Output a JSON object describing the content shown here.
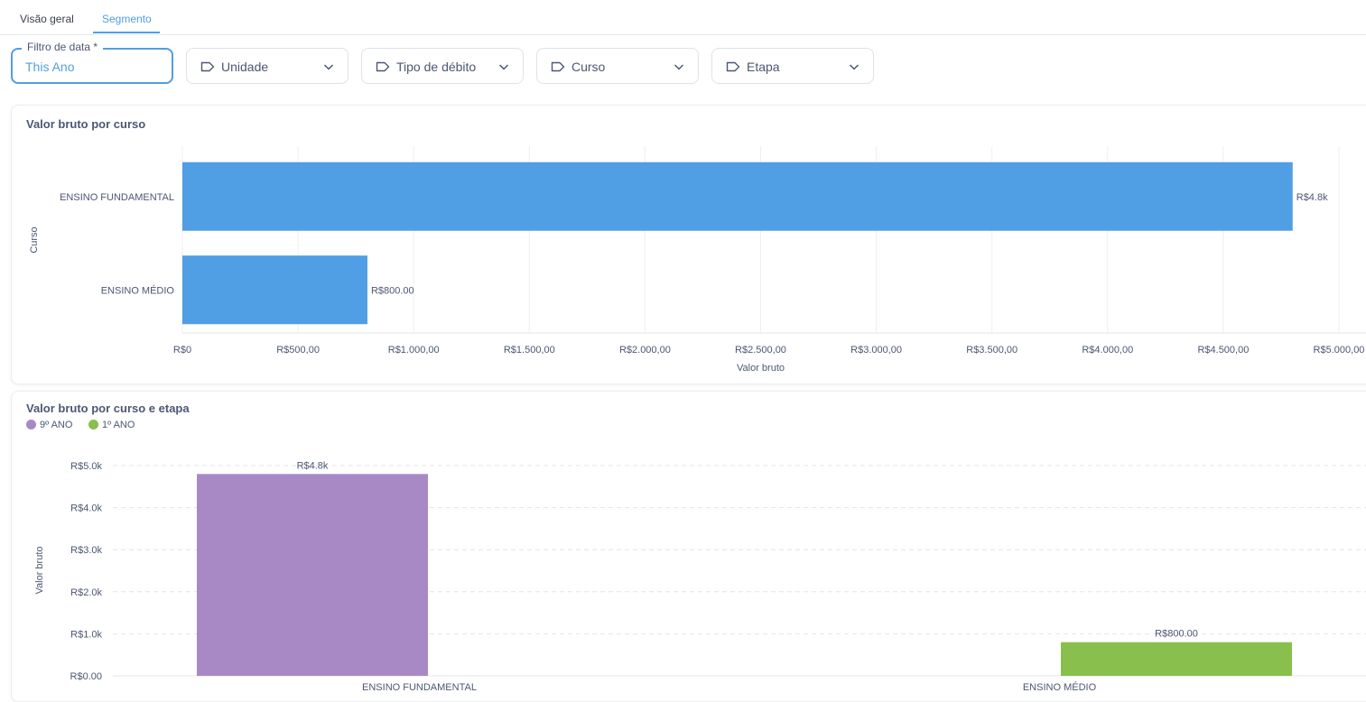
{
  "tabs": [
    {
      "label": "Visão geral",
      "active": false
    },
    {
      "label": "Segmento",
      "active": true
    }
  ],
  "filters": {
    "date": {
      "legend": "Filtro de data *",
      "value": "This Ano"
    },
    "items": [
      {
        "label": "Unidade",
        "icon": "tag-icon"
      },
      {
        "label": "Tipo de débito",
        "icon": "tag-icon"
      },
      {
        "label": "Curso",
        "icon": "tag-icon"
      },
      {
        "label": "Etapa",
        "icon": "tag-icon"
      }
    ]
  },
  "colors": {
    "accent": "#509ee3",
    "purple": "#a989c5",
    "green": "#88bf4d"
  },
  "chart_data": [
    {
      "type": "bar",
      "orientation": "horizontal",
      "title": "Valor bruto por curso",
      "xlabel": "Valor bruto",
      "ylabel": "Curso",
      "categories": [
        "ENSINO FUNDAMENTAL",
        "ENSINO MÉDIO"
      ],
      "values": [
        4800,
        800
      ],
      "data_labels": [
        "R$4.8k",
        "R$800.00"
      ],
      "xlim": [
        0,
        5000
      ],
      "x_ticks": [
        0,
        500,
        1000,
        1500,
        2000,
        2500,
        3000,
        3500,
        4000,
        4500,
        5000
      ],
      "x_tick_labels": [
        "R$0",
        "R$500,00",
        "R$1.000,00",
        "R$1.500,00",
        "R$2.000,00",
        "R$2.500,00",
        "R$3.000,00",
        "R$3.500,00",
        "R$4.000,00",
        "R$4.500,00",
        "R$5.000,00"
      ],
      "color": "#509ee3",
      "grid": true
    },
    {
      "type": "bar",
      "title": "Valor bruto por curso e etapa",
      "xlabel": "",
      "ylabel": "Valor bruto",
      "categories": [
        "ENSINO FUNDAMENTAL",
        "ENSINO MÉDIO"
      ],
      "series": [
        {
          "name": "9º ANO",
          "color": "#a989c5",
          "values": [
            4800,
            null
          ],
          "data_labels": [
            "R$4.8k",
            ""
          ]
        },
        {
          "name": "1º ANO",
          "color": "#88bf4d",
          "values": [
            null,
            800
          ],
          "data_labels": [
            "",
            "R$800.00"
          ]
        }
      ],
      "ylim": [
        0,
        5000
      ],
      "y_ticks": [
        0,
        1000,
        2000,
        3000,
        4000,
        5000
      ],
      "y_tick_labels": [
        "R$0.00",
        "R$1.0k",
        "R$2.0k",
        "R$3.0k",
        "R$4.0k",
        "R$5.0k"
      ],
      "legend": "top-left",
      "grid": true
    }
  ]
}
